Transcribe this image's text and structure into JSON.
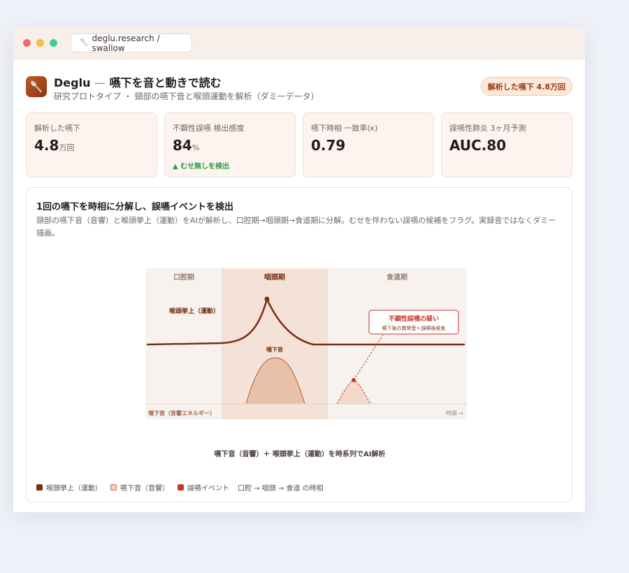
{
  "window": {
    "url": "deglu.research / swallow",
    "url_icon": "spoon-icon"
  },
  "header": {
    "app_icon": "spoon-icon",
    "app_name": "Deglu",
    "separator": "—",
    "title": "嚥下を音と動きで読む",
    "subtitle": "研究プロトタイプ ・ 頸部の嚥下音と喉頭運動を解析（ダミーデータ）",
    "badge": "解析した嚥下 4.8万回"
  },
  "stats": [
    {
      "label": "解析した嚥下",
      "value": "4.8",
      "unit": "万回",
      "delta": ""
    },
    {
      "label": "不顕性誤嚥 検出感度",
      "value": "84",
      "unit": "%",
      "delta": "▲ むせ無しを検出"
    },
    {
      "label": "嚥下時相 一致率(κ)",
      "value": "0.79",
      "unit": "",
      "delta": ""
    },
    {
      "label": "誤嚥性肺炎 3ヶ月予測",
      "value": "AUC.80",
      "unit": "",
      "delta": ""
    }
  ],
  "panel": {
    "title": "1回の嚥下を時相に分解し、誤嚥イベントを検出",
    "description": "頸部の嚥下音（音響）と喉頭挙上（運動）をAIが解析し、口腔期→咽頭期→食道期に分解。むせを伴わない誤嚥の候補をフラグ。実録音ではなくダミー描画。",
    "figure": {
      "phases": [
        "口腔期",
        "咽頭期",
        "食道期"
      ],
      "larynx_label": "喉頭挙上（運動）",
      "sound_peak_label": "嚥下音",
      "alert_title": "不顕性誤嚥の疑い",
      "alert_detail": "嚥下後の異常音＋誤嚥後吸気",
      "bottom_left_label": "嚥下音（音響エネルギー）",
      "time_label": "時間 →",
      "colors": {
        "larynx": "#7a2e12",
        "sound_fill": "#e8c1a8",
        "aspiration": "#c9352a",
        "pharyngeal_band": "#f4e2d8",
        "background": "#f8f2ee"
      }
    },
    "caption": "嚥下音（音響）＋ 喉頭挙上（運動）を時系列でAI解析",
    "legend": {
      "larynx": "喉頭挙上（運動）",
      "sound": "嚥下音（音響）",
      "aspiration": "誤嚥イベント",
      "phase_note": "口腔 → 咽頭 → 食道 の時相"
    }
  }
}
